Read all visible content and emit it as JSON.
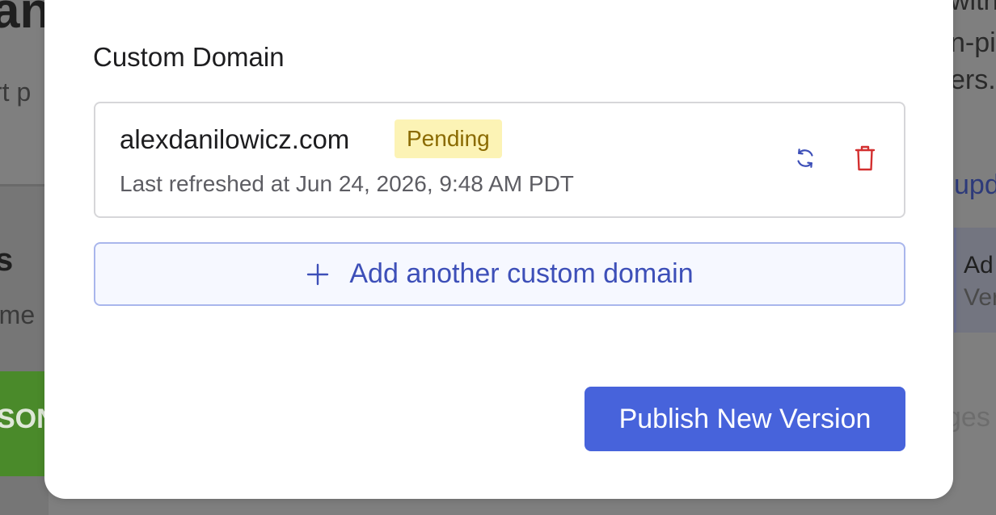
{
  "background": {
    "left_title": "an",
    "left_subtitle": "rt p",
    "left_heading": "s",
    "left_text": "rme",
    "left_button": "SON",
    "right_line1": "with",
    "right_line2": "n-pi",
    "right_line3": "ers.",
    "right_link": "upd",
    "right_card_title": "Ad",
    "right_card_sub": "Ver",
    "right_faded": "ges"
  },
  "modal": {
    "section_title": "Custom Domain",
    "domain": {
      "name": "alexdanilowicz.com",
      "status": "Pending",
      "last_refreshed": "Last refreshed at Jun 24, 2026, 9:48 AM PDT"
    },
    "add_domain_label": "Add another custom domain",
    "publish_label": "Publish New Version"
  },
  "icons": {
    "refresh": "refresh-icon",
    "delete": "trash-icon",
    "add": "plus-icon"
  },
  "colors": {
    "accent": "#4763db",
    "badge_bg": "#fcf3b5",
    "badge_text": "#8a6a00",
    "delete_red": "#d32f2f",
    "refresh_blue": "#3d4fb8"
  }
}
